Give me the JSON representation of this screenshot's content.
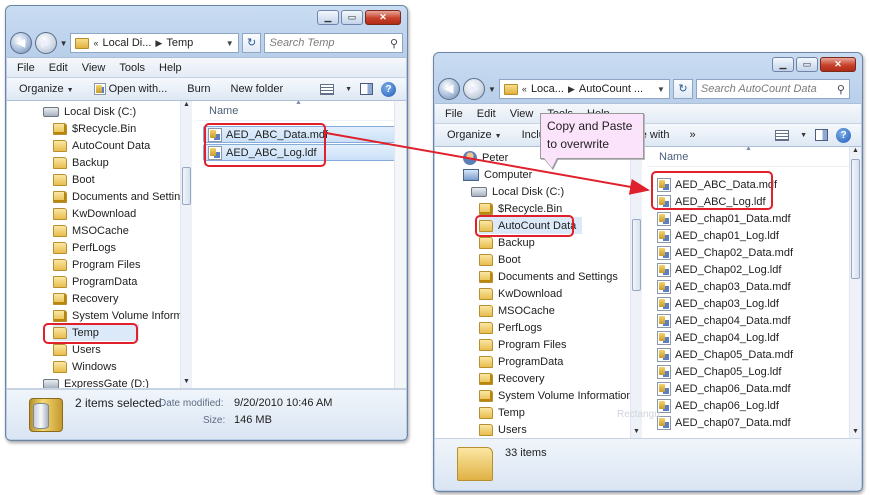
{
  "left_window": {
    "address": [
      "Local Di...",
      "Temp"
    ],
    "search_placeholder": "Search Temp",
    "menu": [
      "File",
      "Edit",
      "View",
      "Tools",
      "Help"
    ],
    "toolbar": [
      "Organize",
      "Open with...",
      "Burn",
      "New folder"
    ],
    "nav_items": [
      "Local Disk (C:)",
      "$Recycle.Bin",
      "AutoCount Data",
      "Backup",
      "Boot",
      "Documents and Settings",
      "KwDownload",
      "MSOCache",
      "PerfLogs",
      "Program Files",
      "ProgramData",
      "Recovery",
      "System Volume Informatio",
      "Temp",
      "Users",
      "Windows",
      "ExpressGate (D:)"
    ],
    "column_header": "Name",
    "files": [
      "AED_ABC_Data.mdf",
      "AED_ABC_Log.ldf"
    ],
    "status": {
      "selected": "2 items selected",
      "date_label": "Date modified:",
      "date_value": "9/20/2010 10:46 AM",
      "size_label": "Size:",
      "size_value": "146 MB"
    }
  },
  "right_window": {
    "address": [
      "Loca...",
      "AutoCount ..."
    ],
    "search_placeholder": "Search AutoCount Data",
    "menu": [
      "File",
      "Edit",
      "View",
      "Tools",
      "Help"
    ],
    "toolbar": [
      "Organize",
      "Inclu",
      "hare with",
      "»"
    ],
    "nav_items": [
      "Peter",
      "Computer",
      "Local Disk (C:)",
      "$Recycle.Bin",
      "AutoCount Data",
      "Backup",
      "Boot",
      "Documents and Settings",
      "KwDownload",
      "MSOCache",
      "PerfLogs",
      "Program Files",
      "ProgramData",
      "Recovery",
      "System Volume Information",
      "Temp",
      "Users"
    ],
    "column_header": "Name",
    "files": [
      "AED_ABC_Data.mdf",
      "AED_ABC_Log.ldf",
      "AED_chap01_Data.mdf",
      "AED_chap01_Log.ldf",
      "AED_Chap02_Data.mdf",
      "AED_Chap02_Log.ldf",
      "AED_chap03_Data.mdf",
      "AED_chap03_Log.ldf",
      "AED_chap04_Data.mdf",
      "AED_chap04_Log.ldf",
      "AED_Chap05_Data.mdf",
      "AED_Chap05_Log.ldf",
      "AED_chap06_Data.mdf",
      "AED_chap06_Log.ldf",
      "AED_chap07_Data.mdf"
    ],
    "status": {
      "count": "33 items"
    }
  },
  "callout": {
    "text": "Copy and Paste to overwrite"
  },
  "ghost_text": "Rectangu",
  "colors": {
    "highlight": "#e0202a",
    "callout_fill": "#fbe3fb",
    "selection": "#cbe1f8"
  }
}
